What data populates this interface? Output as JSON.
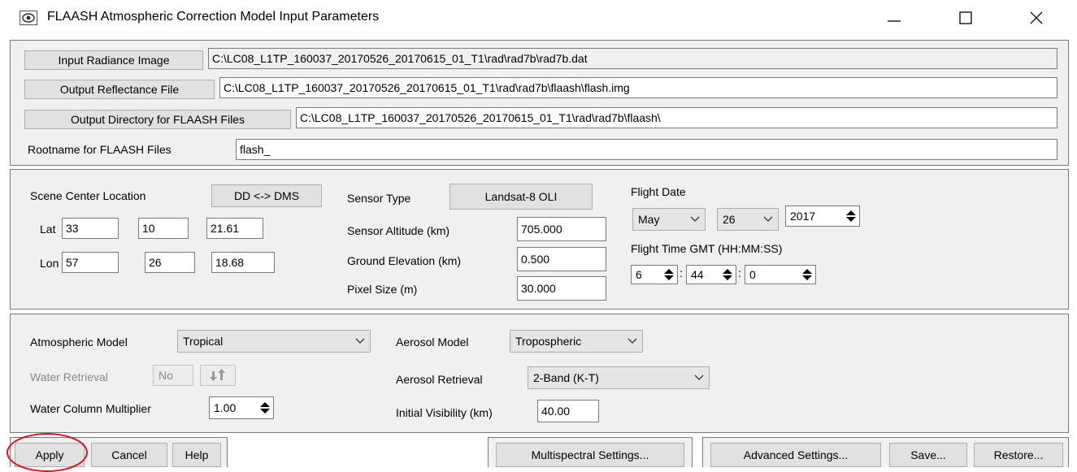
{
  "window": {
    "title": "FLAASH Atmospheric Correction Model Input Parameters",
    "icon": "envi-eye-icon",
    "controls": [
      "minimize-icon",
      "maximize-icon",
      "close-icon"
    ]
  },
  "files": {
    "input_radiance_label": "Input Radiance Image",
    "input_radiance_value": "C:\\LC08_L1TP_160037_20170526_20170615_01_T1\\rad\\rad7b\\rad7b.dat",
    "output_reflectance_label": "Output Reflectance File",
    "output_reflectance_value": "C:\\LC08_L1TP_160037_20170526_20170615_01_T1\\rad\\rad7b\\flaash\\flash.img",
    "output_directory_label": "Output Directory for FLAASH Files",
    "output_directory_value": "C:\\LC08_L1TP_160037_20170526_20170615_01_T1\\rad\\rad7b\\flaash\\",
    "rootname_label": "Rootname for FLAASH Files",
    "rootname_value": "flash_"
  },
  "scene": {
    "center_label": "Scene Center Location",
    "dd_dms_label": "DD <-> DMS",
    "lat_label": "Lat",
    "lat": [
      "33",
      "10",
      "21.61"
    ],
    "lon_label": "Lon",
    "lon": [
      "57",
      "26",
      "18.68"
    ],
    "sensor_type_label": "Sensor Type",
    "sensor_type_value": "Landsat-8 OLI",
    "sensor_altitude_label": "Sensor Altitude (km)",
    "sensor_altitude_value": "705.000",
    "ground_elevation_label": "Ground Elevation (km)",
    "ground_elevation_value": "0.500",
    "pixel_size_label": "Pixel Size (m)",
    "pixel_size_value": "30.000",
    "flight_date_label": "Flight Date",
    "flight_month": "May",
    "flight_day": "26",
    "flight_year": "2017",
    "flight_time_label": "Flight Time GMT (HH:MM:SS)",
    "flight_hh": "6",
    "flight_mm": "44",
    "flight_ss": "0",
    "time_sep": ":"
  },
  "model": {
    "atmospheric_model_label": "Atmospheric Model",
    "atmospheric_model_value": "Tropical",
    "water_retrieval_label": "Water Retrieval",
    "water_retrieval_value": "No",
    "water_column_label": "Water Column Multiplier",
    "water_column_value": "1.00",
    "aerosol_model_label": "Aerosol Model",
    "aerosol_model_value": "Tropospheric",
    "aerosol_retrieval_label": "Aerosol Retrieval",
    "aerosol_retrieval_value": "2-Band (K-T)",
    "initial_visibility_label": "Initial Visibility (km)",
    "initial_visibility_value": "40.00"
  },
  "buttons": {
    "apply": "Apply",
    "cancel": "Cancel",
    "help": "Help",
    "multispectral": "Multispectral Settings...",
    "advanced": "Advanced Settings...",
    "save": "Save...",
    "restore": "Restore..."
  },
  "colors": {
    "panel_bg": "#f0f0f0",
    "border": "#7a7a7a",
    "highlight": "#e0101a"
  }
}
